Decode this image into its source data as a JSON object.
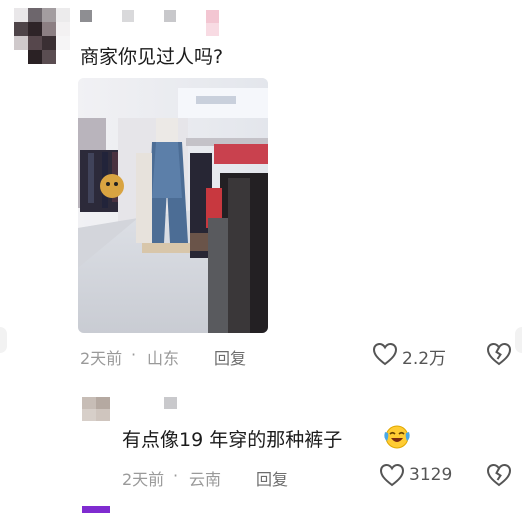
{
  "comment1": {
    "text": "商家你见过人吗?",
    "time": "2天前",
    "location": "山东",
    "reply_label": "回复",
    "like_count": "2.2万"
  },
  "comment2": {
    "text": "有点像19 年穿的那种裤子",
    "time": "2天前",
    "location": "云南",
    "reply_label": "回复",
    "like_count": "3129"
  },
  "meta_separator": "·",
  "icons": {
    "like": "heart-outline-icon",
    "dislike": "broken-heart-icon",
    "emoji": "crying-laughing-emoji-icon"
  },
  "colors": {
    "text": "#1b1b1b",
    "meta": "#9a9a9a",
    "icon": "#555555"
  }
}
